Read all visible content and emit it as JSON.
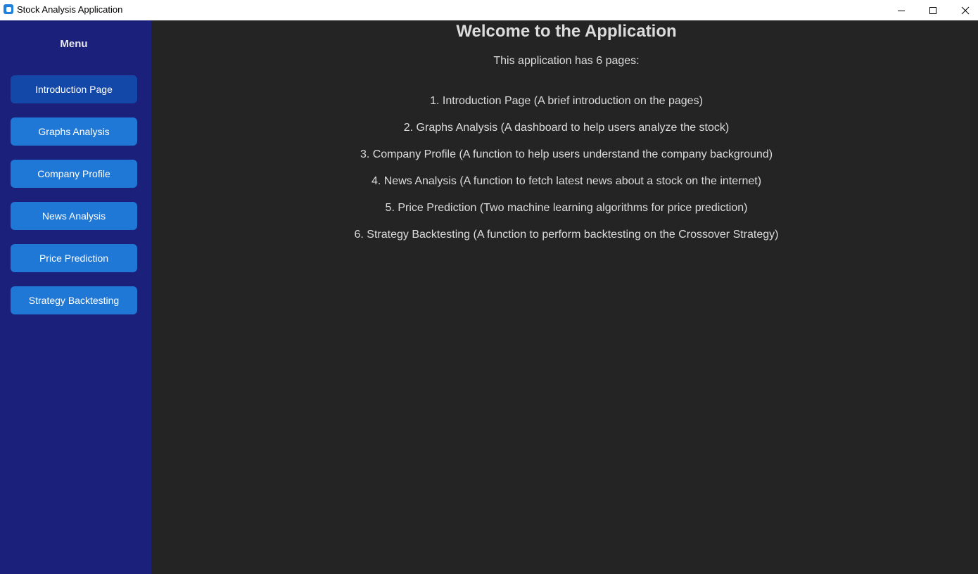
{
  "window": {
    "title": "Stock Analysis Application",
    "icon": "app-icon",
    "accent": "#1e7fdc"
  },
  "sidebar": {
    "title": "Menu",
    "background": "#1b207a",
    "items": [
      {
        "label": "Introduction Page",
        "active": true
      },
      {
        "label": "Graphs Analysis",
        "active": false
      },
      {
        "label": "Company Profile",
        "active": false
      },
      {
        "label": "News Analysis",
        "active": false
      },
      {
        "label": "Price Prediction",
        "active": false
      },
      {
        "label": "Strategy Backtesting",
        "active": false
      }
    ],
    "button_color": "#1f78d6",
    "active_button_color": "#1348a8"
  },
  "main": {
    "heading": "Welcome to the Application",
    "subtitle": "This application has 6 pages:",
    "pages": [
      "1. Introduction Page (A brief introduction on the pages)",
      "2. Graphs Analysis (A dashboard to help users analyze the stock)",
      "3. Company Profile (A function to help users understand the company background)",
      "4. News Analysis (A function to fetch latest news about a stock on the internet)",
      "5. Price Prediction (Two machine learning algorithms for price prediction)",
      "6. Strategy Backtesting (A function to perform backtesting on the Crossover Strategy)"
    ],
    "background": "#242424"
  }
}
